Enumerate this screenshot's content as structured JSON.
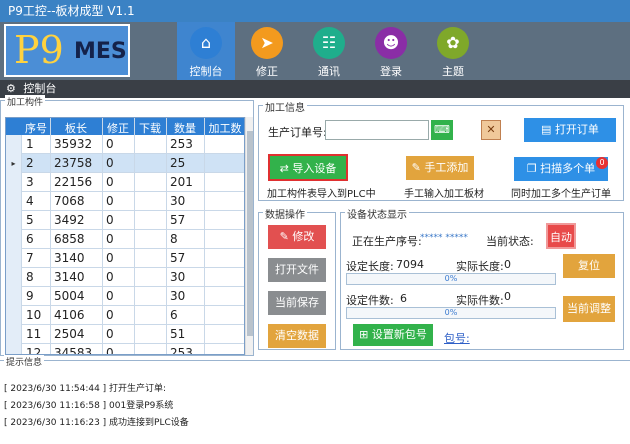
{
  "window": {
    "title": "P9工控--板材成型  V1.1"
  },
  "logo": {
    "p9": "P9",
    "mes": "MES"
  },
  "nav": [
    {
      "label": "控制台",
      "icon": "home-icon",
      "glyph": "⌂",
      "color": "#2e7fd4",
      "active": true
    },
    {
      "label": "修正",
      "icon": "send-icon",
      "glyph": "➤",
      "color": "#f39a1e",
      "active": false
    },
    {
      "label": "通讯",
      "icon": "id-card-icon",
      "glyph": "☷",
      "color": "#1fae8c",
      "active": false
    },
    {
      "label": "登录",
      "icon": "user-icon",
      "glyph": "☻",
      "color": "#8a2da6",
      "active": false
    },
    {
      "label": "主题",
      "icon": "gear-icon",
      "glyph": "✿",
      "color": "#7fa82a",
      "active": false
    }
  ],
  "subbar": {
    "title": "控制台"
  },
  "parts": {
    "legend": "加工构件",
    "columns": [
      "序号",
      "板长",
      "修正",
      "下载",
      "数量",
      "加工数"
    ],
    "rows": [
      [
        "1",
        "35932",
        "0",
        "",
        "253",
        ""
      ],
      [
        "2",
        "23758",
        "0",
        "",
        "25",
        ""
      ],
      [
        "3",
        "22156",
        "0",
        "",
        "201",
        ""
      ],
      [
        "4",
        "7068",
        "0",
        "",
        "30",
        ""
      ],
      [
        "5",
        "3492",
        "0",
        "",
        "57",
        ""
      ],
      [
        "6",
        "6858",
        "0",
        "",
        "8",
        ""
      ],
      [
        "7",
        "3140",
        "0",
        "",
        "57",
        ""
      ],
      [
        "8",
        "3140",
        "0",
        "",
        "30",
        ""
      ],
      [
        "9",
        "5004",
        "0",
        "",
        "30",
        ""
      ],
      [
        "10",
        "4106",
        "0",
        "",
        "6",
        ""
      ],
      [
        "11",
        "2504",
        "0",
        "",
        "51",
        ""
      ],
      [
        "12",
        "34583",
        "0",
        "",
        "253",
        ""
      ]
    ],
    "selected_index": 1
  },
  "info": {
    "legend": "加工信息",
    "order_label": "生产订单号:",
    "order_value": "",
    "open_order": "打开订单",
    "import_device": "导入设备",
    "import_caption": "加工构件表导入到PLC中",
    "manual_add": "手工添加",
    "manual_caption": "手工输入加工板材",
    "scan_multi": "扫描多个单",
    "scan_badge": "0",
    "scan_caption": "同时加工多个生产订单"
  },
  "data_ops": {
    "legend": "数据操作",
    "modify": "修改",
    "open_file": "打开文件",
    "save_current": "当前保存",
    "clear_data": "清空数据"
  },
  "device": {
    "legend": "设备状态显示",
    "seq_label": "正在生产序号:",
    "seq_value": "***** *****",
    "state_label": "当前状态:",
    "state_value": "自动",
    "set_length_label": "设定长度:",
    "set_length_value": "7094",
    "actual_length_label": "实际长度:",
    "actual_length_value": "0",
    "length_progress": "0%",
    "set_count_label": "设定件数:",
    "set_count_value": "6",
    "actual_count_label": "实际件数:",
    "actual_count_value": "0",
    "count_progress": "0%",
    "reset": "复位",
    "adjust": "当前调整",
    "new_package": "设置新包号",
    "package_label": "包号:"
  },
  "log": {
    "legend": "提示信息",
    "lines": [
      "[ 2023/6/30  11:54:44 ] 打开生产订单:",
      "[ 2023/6/30  11:16:58 ] 001登录P9系统",
      "[ 2023/6/30  11:16:23 ] 成功连接到PLC设备"
    ]
  }
}
